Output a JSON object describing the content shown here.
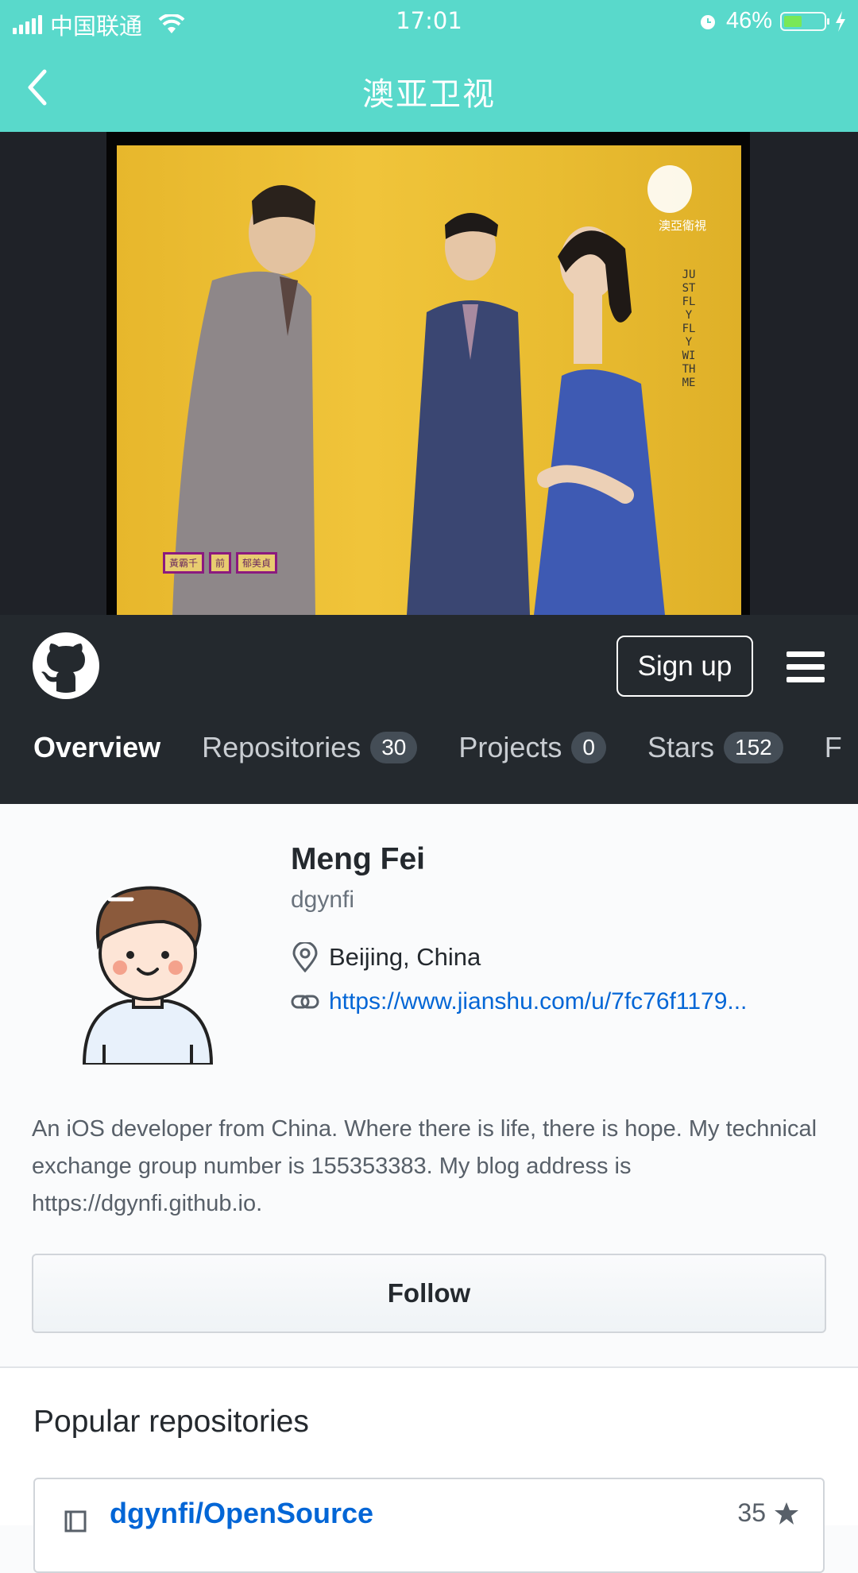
{
  "status_bar": {
    "carrier": "中国联通",
    "time": "17:01",
    "battery": "46%",
    "battery_level": 0.46
  },
  "nav": {
    "title": "澳亚卫视"
  },
  "video": {
    "channel_logo_text": "澳亞衛視",
    "vertical_text": "JUST FLY FLY WITH ME",
    "caption": [
      "黃霸千",
      "前",
      "郁美貞"
    ]
  },
  "github": {
    "signup_label": "Sign up",
    "tabs": [
      {
        "label": "Overview",
        "count": null
      },
      {
        "label": "Repositories",
        "count": "30"
      },
      {
        "label": "Projects",
        "count": "0"
      },
      {
        "label": "Stars",
        "count": "152"
      },
      {
        "label": "F",
        "count": null
      }
    ]
  },
  "profile": {
    "name": "Meng Fei",
    "login": "dgynfi",
    "location": "Beijing, China",
    "website": "https://www.jianshu.com/u/7fc76f1179...",
    "bio": "An iOS developer from China. Where there is life, there is hope. My technical exchange group number is 155353383. My blog address is https://dgynfi.github.io.",
    "follow_label": "Follow"
  },
  "popular": {
    "title": "Popular repositories",
    "repos": [
      {
        "name": "dgynfi/OpenSource",
        "stars": "35"
      }
    ]
  }
}
